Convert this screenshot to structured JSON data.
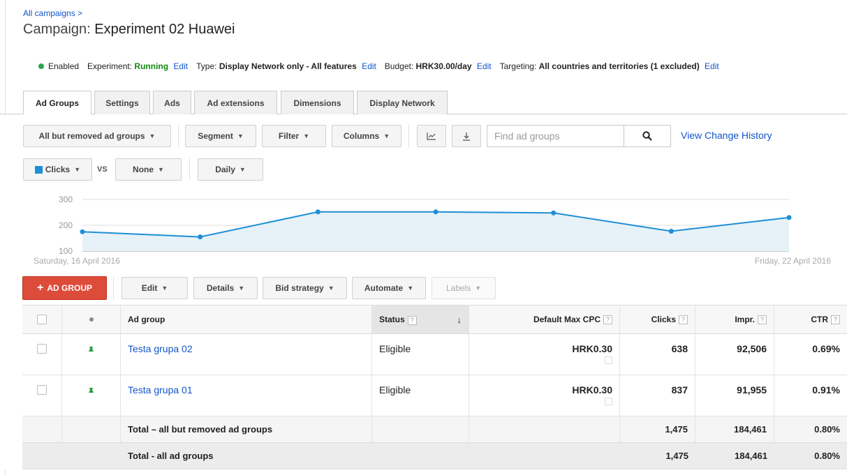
{
  "breadcrumb": "All campaigns >",
  "title": {
    "prefix": "Campaign:",
    "name": "Experiment 02 Huawei"
  },
  "status": {
    "enabled": "Enabled",
    "experiment_label": "Experiment:",
    "experiment_value": "Running",
    "type_label": "Type:",
    "type_value": "Display Network only - All features",
    "budget_label": "Budget:",
    "budget_value": "HRK30.00/day",
    "targeting_label": "Targeting:",
    "targeting_value": "All countries and territories (1 excluded)",
    "edit": "Edit"
  },
  "tabs": [
    "Ad Groups",
    "Settings",
    "Ads",
    "Ad extensions",
    "Dimensions",
    "Display Network"
  ],
  "toolbar": {
    "filter_scope": "All but removed ad groups",
    "segment": "Segment",
    "filter": "Filter",
    "columns": "Columns",
    "search_placeholder": "Find ad groups",
    "view_history": "View Change History"
  },
  "chart_controls": {
    "metric1": "Clicks",
    "vs": "VS",
    "metric2": "None",
    "period": "Daily"
  },
  "chart_data": {
    "type": "area",
    "x": [
      "Saturday, 16 April 2016",
      "",
      "",
      "",
      "",
      "",
      "Friday, 22 April 2016"
    ],
    "series": [
      {
        "name": "Clicks",
        "values": [
          175,
          155,
          252,
          252,
          248,
          177,
          230
        ]
      }
    ],
    "yticks": [
      "300",
      "200",
      "100"
    ],
    "ylim": [
      100,
      300
    ],
    "start_label": "Saturday, 16 April 2016",
    "end_label": "Friday, 22 April 2016",
    "color": "#1e8fd6"
  },
  "actions": {
    "add": "AD GROUP",
    "edit": "Edit",
    "details": "Details",
    "bid_strategy": "Bid strategy",
    "automate": "Automate",
    "labels": "Labels"
  },
  "table": {
    "headers": {
      "ad_group": "Ad group",
      "status": "Status",
      "max_cpc": "Default Max CPC",
      "clicks": "Clicks",
      "impr": "Impr.",
      "ctr": "CTR"
    },
    "rows": [
      {
        "name": "Testa grupa 02",
        "status": "Eligible",
        "cpc": "HRK0.30",
        "clicks": "638",
        "impr": "92,506",
        "ctr": "0.69%"
      },
      {
        "name": "Testa grupa 01",
        "status": "Eligible",
        "cpc": "HRK0.30",
        "clicks": "837",
        "impr": "91,955",
        "ctr": "0.91%"
      }
    ],
    "totals": [
      {
        "label": "Total – all but removed ad groups",
        "clicks": "1,475",
        "impr": "184,461",
        "ctr": "0.80%"
      },
      {
        "label": "Total - all ad groups",
        "clicks": "1,475",
        "impr": "184,461",
        "ctr": "0.80%"
      }
    ]
  }
}
